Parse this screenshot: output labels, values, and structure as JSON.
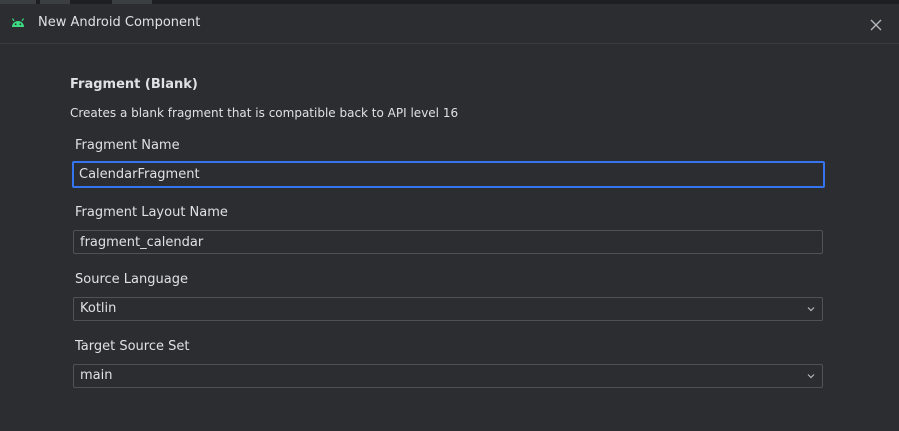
{
  "dialog": {
    "title": "New Android Component",
    "title_icon": "android-icon",
    "close_icon": "close-icon"
  },
  "template": {
    "heading": "Fragment (Blank)",
    "description": "Creates a blank fragment that is compatible back to API level 16"
  },
  "fields": {
    "fragment_name": {
      "label": "Fragment Name",
      "value": "CalendarFragment"
    },
    "layout_name": {
      "label": "Fragment Layout Name",
      "value": "fragment_calendar"
    },
    "source_language": {
      "label": "Source Language",
      "value": "Kotlin"
    },
    "target_source_set": {
      "label": "Target Source Set",
      "value": "main"
    }
  },
  "colors": {
    "background": "#2b2d30",
    "accent_focus": "#3574f0",
    "android_green": "#3ddc84",
    "text": "#dfe1e5"
  }
}
